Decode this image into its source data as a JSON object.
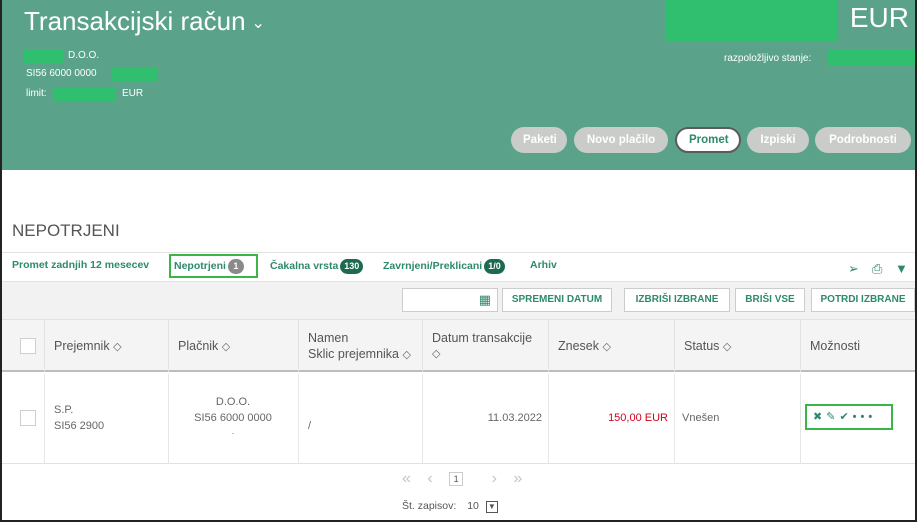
{
  "header": {
    "title": "Transakcijski račun",
    "company_suffix": "D.O.O.",
    "iban_prefix": "SI56 6000 0000",
    "limit_label": "limit:",
    "limit_currency": "EUR",
    "currency": "EUR",
    "available_label": "razpoložljivo stanje:",
    "buttons": [
      "Paketi",
      "Novo plačilo",
      "Promet",
      "Izpiski",
      "Podrobnosti"
    ],
    "active_button": "Promet",
    "colors": {
      "header_bg": "#5aa38a",
      "mask_green": "#2fbf6e",
      "accent": "#2d8a6a"
    }
  },
  "section_title": "NEPOTRJENI",
  "tabs": [
    {
      "label": "Promet zadnjih 12 mesecev",
      "badge": ""
    },
    {
      "label": "Nepotrjeni",
      "badge": "1"
    },
    {
      "label": "Čakalna vrsta",
      "badge": "130"
    },
    {
      "label": "Zavrnjeni/Preklicani",
      "badge": "1/0"
    },
    {
      "label": "Arhiv",
      "badge": ""
    }
  ],
  "toolbar_icons": [
    "send-icon",
    "print-icon",
    "filter-icon"
  ],
  "actions": {
    "date_placeholder": "",
    "change_date": "SPREMENI DATUM",
    "delete_selected": "IZBRIŠI IZBRANE",
    "delete_all": "BRIŠI VSE",
    "confirm_selected": "POTRDI IZBRANE"
  },
  "table": {
    "columns": [
      {
        "line1": "Prejemnik",
        "line2": ""
      },
      {
        "line1": "Plačnik",
        "line2": ""
      },
      {
        "line1": "Namen",
        "line2": "Sklic prejemnika"
      },
      {
        "line1": "Datum transakcije",
        "line2": ""
      },
      {
        "line1": "Znesek",
        "line2": ""
      },
      {
        "line1": "Status",
        "line2": ""
      },
      {
        "line1": "Možnosti",
        "line2": ""
      }
    ],
    "rows": [
      {
        "recipient_name": "S.P.",
        "recipient_account": "SI56 2900",
        "payer_name": "D.O.O.",
        "payer_account": "SI56 6000 0000",
        "payer_extra": ".",
        "purpose": "/",
        "date": "11.03.2022",
        "amount": "150,00 EUR",
        "status": "Vnešen",
        "option_icons": [
          "delete-icon",
          "edit-icon",
          "confirm-icon",
          "more-icon"
        ]
      }
    ]
  },
  "pagination": {
    "first": "«",
    "prev": "‹",
    "current_page": "1",
    "next": "›",
    "last": "»",
    "records_label": "Št. zapisov:",
    "records_value": "10"
  }
}
